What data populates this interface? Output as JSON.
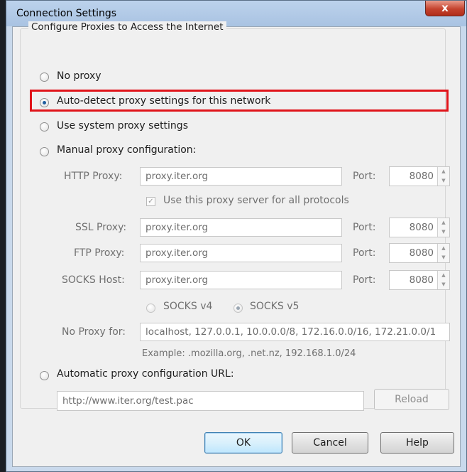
{
  "window": {
    "title": "Connection Settings",
    "close_glyph": "x"
  },
  "group": {
    "title": "Configure Proxies to Access the Internet"
  },
  "options": {
    "no_proxy": "No proxy",
    "auto_detect": "Auto-detect proxy settings for this network",
    "system": "Use system proxy settings",
    "manual": "Manual proxy configuration:",
    "auto_url": "Automatic proxy configuration URL:",
    "selected": "auto_detect"
  },
  "manual": {
    "http_label": "HTTP Proxy:",
    "http_value": "proxy.iter.org",
    "http_port_label": "Port:",
    "http_port": "8080",
    "use_for_all": "Use this proxy server for all protocols",
    "use_for_all_checked": true,
    "ssl_label": "SSL Proxy:",
    "ssl_value": "proxy.iter.org",
    "ssl_port_label": "Port:",
    "ssl_port": "8080",
    "ftp_label": "FTP Proxy:",
    "ftp_value": "proxy.iter.org",
    "ftp_port_label": "Port:",
    "ftp_port": "8080",
    "socks_label": "SOCKS Host:",
    "socks_value": "proxy.iter.org",
    "socks_port_label": "Port:",
    "socks_port": "8080",
    "socks_v4": "SOCKS v4",
    "socks_v5": "SOCKS v5",
    "socks_selected": "v5",
    "no_proxy_label": "No Proxy for:",
    "no_proxy_value": "localhost, 127.0.0.1, 10.0.0.0/8, 172.16.0.0/16, 172.21.0.0/1",
    "example": "Example: .mozilla.org, .net.nz, 192.168.1.0/24"
  },
  "auto_config": {
    "url_value": "http://www.iter.org/test.pac",
    "reload_label": "Reload"
  },
  "buttons": {
    "ok": "OK",
    "cancel": "Cancel",
    "help": "Help"
  },
  "colors": {
    "highlight_border": "#e0141a",
    "close_button": "#c5432e",
    "title_bar": "#bcd2ec"
  },
  "icons": {
    "close": "close-icon",
    "spin_up": "spin-up-icon",
    "spin_down": "spin-down-icon",
    "check": "checkmark-icon"
  }
}
